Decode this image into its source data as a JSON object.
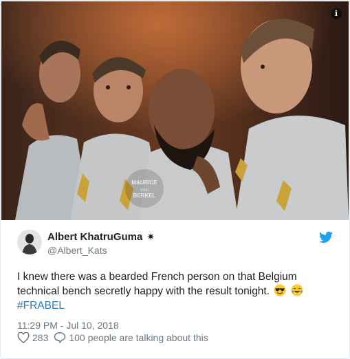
{
  "photo": {
    "watermark_top": "MAURICE",
    "watermark_mid": "VAN",
    "watermark_bottom": "BERKEL",
    "info_icon": "info-icon"
  },
  "author": {
    "display_name": "Albert KhatruGuma",
    "badge": "✷",
    "handle": "@Albert_Kats"
  },
  "tweet": {
    "text": "I knew there was a bearded French person on that Belgium technical bench secretly happy with the result tonight.",
    "emoji_1": "smiling-face-with-sunglasses",
    "emoji_2": "face-with-tears-of-joy",
    "hashtag": "#FRABEL",
    "timestamp": "11:29 PM - Jul 10, 2018"
  },
  "actions": {
    "likes": "283",
    "talking": "100 people are talking about this"
  },
  "colors": {
    "link": "#2b7bb9",
    "secondary": "#697882",
    "twitter_blue": "#1da1f2"
  }
}
